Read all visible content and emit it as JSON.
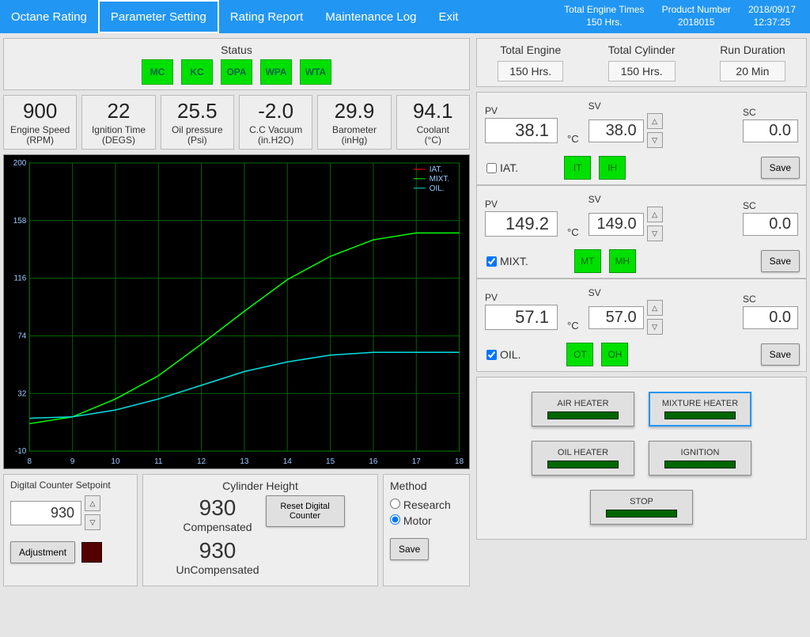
{
  "header": {
    "menu": [
      "Octane Rating",
      "Parameter Setting",
      "Rating Report",
      "Maintenance Log",
      "Exit"
    ],
    "active_index": 1,
    "info": {
      "total_engine_times_label": "Total Engine Times",
      "total_engine_times": "150 Hrs.",
      "product_number_label": "Product Number",
      "product_number": "2018015",
      "date": "2018/09/17",
      "time": "12:37:25"
    }
  },
  "status": {
    "title": "Status",
    "boxes": [
      "MC",
      "KC",
      "OPA",
      "WPA",
      "WTA"
    ]
  },
  "gauges": [
    {
      "val": "900",
      "lab1": "Engine Speed",
      "lab2": "(RPM)"
    },
    {
      "val": "22",
      "lab1": "Ignition Time",
      "lab2": "(DEGS)"
    },
    {
      "val": "25.5",
      "lab1": "Oil pressure",
      "lab2": "(Psi)"
    },
    {
      "val": "-2.0",
      "lab1": "C.C Vacuum",
      "lab2": "(in.H2O)"
    },
    {
      "val": "29.9",
      "lab1": "Barometer",
      "lab2": "(inHg)"
    },
    {
      "val": "94.1",
      "lab1": "Coolant",
      "lab2": "(°C)"
    }
  ],
  "chart_data": {
    "type": "line",
    "xlabel": "",
    "ylabel": "",
    "xlim": [
      8,
      18
    ],
    "ylim": [
      -10,
      200
    ],
    "xticks": [
      8,
      9,
      10,
      11,
      12,
      13,
      14,
      15,
      16,
      17,
      18
    ],
    "yticks": [
      -10,
      32,
      74,
      116,
      158,
      200
    ],
    "legend_pos": "top-right",
    "series": [
      {
        "name": "IAT.",
        "color": "#ff0000",
        "x": [
          8,
          9,
          10,
          11,
          12,
          13,
          14,
          15,
          16,
          17,
          18
        ],
        "y": [
          null,
          null,
          null,
          null,
          null,
          null,
          null,
          null,
          null,
          null,
          null
        ]
      },
      {
        "name": "MIXT.",
        "color": "#00ff00",
        "x": [
          8,
          9,
          10,
          11,
          12,
          13,
          14,
          15,
          16,
          17,
          18
        ],
        "y": [
          10,
          15,
          28,
          45,
          68,
          92,
          115,
          132,
          144,
          149,
          149
        ]
      },
      {
        "name": "OIL.",
        "color": "#00e0e0",
        "x": [
          8,
          9,
          10,
          11,
          12,
          13,
          14,
          15,
          16,
          17,
          18
        ],
        "y": [
          14,
          15,
          20,
          28,
          38,
          48,
          55,
          60,
          62,
          62,
          62
        ]
      }
    ]
  },
  "cylinder": {
    "dc_label": "Digital Counter Setpoint",
    "dc_value": "930",
    "adjustment_label": "Adjustment",
    "title": "Cylinder Height",
    "compensated_val": "930",
    "compensated_lab": "Compensated",
    "uncompensated_val": "930",
    "uncompensated_lab": "UnCompensated",
    "reset_label": "Reset Digital Counter"
  },
  "method": {
    "title": "Method",
    "opt1": "Research",
    "opt2": "Motor",
    "selected": "Motor",
    "save": "Save"
  },
  "right_top": {
    "c1_lab": "Total Engine",
    "c1_val": "150 Hrs.",
    "c2_lab": "Total Cylinder",
    "c2_val": "150 Hrs.",
    "c3_lab": "Run Duration",
    "c3_val": "20 Min"
  },
  "cards": [
    {
      "name": "IAT.",
      "checked": false,
      "pv": "38.1",
      "sv": "38.0",
      "sc": "0.0",
      "unit": "°C",
      "b1": "IT",
      "b2": "IH"
    },
    {
      "name": "MIXT.",
      "checked": true,
      "pv": "149.2",
      "sv": "149.0",
      "sc": "0.0",
      "unit": "°C",
      "b1": "MT",
      "b2": "MH"
    },
    {
      "name": "OIL.",
      "checked": true,
      "pv": "57.1",
      "sv": "57.0",
      "sc": "0.0",
      "unit": "°C",
      "b1": "OT",
      "b2": "OH"
    }
  ],
  "labels": {
    "pv": "PV",
    "sv": "SV",
    "sc": "SC",
    "save": "Save"
  },
  "big_buttons": [
    "AIR HEATER",
    "MIXTURE HEATER",
    "OIL HEATER",
    "IGNITION",
    "STOP"
  ],
  "big_buttons_selected_index": 1
}
